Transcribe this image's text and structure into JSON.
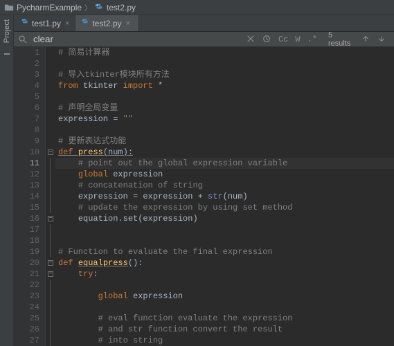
{
  "breadcrumb": {
    "project": "PycharmExample",
    "file": "test2.py"
  },
  "tabs": [
    {
      "label": "test1.py",
      "active": false
    },
    {
      "label": "test2.py",
      "active": true
    }
  ],
  "sidebar": {
    "project_label": "Project"
  },
  "search": {
    "value": "clear",
    "cc_label": "Cc",
    "w_label": "W",
    "star_label": ".*",
    "results_text": "5 results"
  },
  "code": {
    "lines": [
      {
        "n": 1,
        "indent": 0,
        "tokens": [
          [
            "comment",
            "# 简易计算器"
          ]
        ]
      },
      {
        "n": 2,
        "indent": 0,
        "tokens": []
      },
      {
        "n": 3,
        "indent": 0,
        "tokens": [
          [
            "comment",
            "# 导入tkinter模块所有方法"
          ]
        ]
      },
      {
        "n": 4,
        "indent": 0,
        "tokens": [
          [
            "kw",
            "from "
          ],
          [
            "def",
            "tkinter "
          ],
          [
            "kw",
            "import "
          ],
          [
            "def",
            "*"
          ]
        ]
      },
      {
        "n": 5,
        "indent": 0,
        "tokens": []
      },
      {
        "n": 6,
        "indent": 0,
        "tokens": [
          [
            "comment",
            "# 声明全局变量"
          ]
        ]
      },
      {
        "n": 7,
        "indent": 0,
        "tokens": [
          [
            "def",
            "expression = "
          ],
          [
            "str",
            "\"\""
          ]
        ]
      },
      {
        "n": 8,
        "indent": 0,
        "tokens": []
      },
      {
        "n": 9,
        "indent": 0,
        "tokens": [
          [
            "comment",
            "# 更新表达式功能"
          ]
        ]
      },
      {
        "n": 10,
        "indent": 0,
        "tokens": [
          [
            "kw_und",
            "def "
          ],
          [
            "fn_und",
            "press"
          ],
          [
            "def_und",
            "(num):"
          ]
        ]
      },
      {
        "n": 11,
        "indent": 1,
        "tokens": [
          [
            "comment",
            "# point out the global expression variable"
          ]
        ],
        "active": true
      },
      {
        "n": 12,
        "indent": 1,
        "tokens": [
          [
            "kw",
            "global "
          ],
          [
            "def",
            "expression"
          ]
        ]
      },
      {
        "n": 13,
        "indent": 1,
        "tokens": [
          [
            "comment",
            "# concatenation of string"
          ]
        ]
      },
      {
        "n": 14,
        "indent": 1,
        "tokens": [
          [
            "def",
            "expression = expression + "
          ],
          [
            "builtin",
            "str"
          ],
          [
            "def",
            "(num)"
          ]
        ]
      },
      {
        "n": 15,
        "indent": 1,
        "tokens": [
          [
            "comment",
            "# update the expression by using set method"
          ]
        ]
      },
      {
        "n": 16,
        "indent": 1,
        "tokens": [
          [
            "def",
            "equation.set(expression)"
          ]
        ]
      },
      {
        "n": 17,
        "indent": 0,
        "tokens": []
      },
      {
        "n": 18,
        "indent": 0,
        "tokens": []
      },
      {
        "n": 19,
        "indent": 0,
        "tokens": [
          [
            "comment",
            "# Function to evaluate the final expression"
          ]
        ]
      },
      {
        "n": 20,
        "indent": 0,
        "tokens": [
          [
            "kw",
            "def "
          ],
          [
            "fn_und",
            "equalpress"
          ],
          [
            "def",
            "():"
          ]
        ]
      },
      {
        "n": 21,
        "indent": 1,
        "tokens": [
          [
            "kw",
            "try"
          ],
          [
            "def",
            ":"
          ]
        ]
      },
      {
        "n": 22,
        "indent": 0,
        "tokens": []
      },
      {
        "n": 23,
        "indent": 2,
        "tokens": [
          [
            "kw",
            "global "
          ],
          [
            "def",
            "expression"
          ]
        ]
      },
      {
        "n": 24,
        "indent": 0,
        "tokens": []
      },
      {
        "n": 25,
        "indent": 2,
        "tokens": [
          [
            "comment",
            "# eval function evaluate the expression"
          ]
        ]
      },
      {
        "n": 26,
        "indent": 2,
        "tokens": [
          [
            "comment",
            "# and str function convert the result"
          ]
        ]
      },
      {
        "n": 27,
        "indent": 2,
        "tokens": [
          [
            "comment",
            "# into string"
          ]
        ]
      }
    ]
  },
  "fold": {
    "marks": {
      "10": "open",
      "16": "close",
      "20": "open",
      "21": "open"
    }
  }
}
